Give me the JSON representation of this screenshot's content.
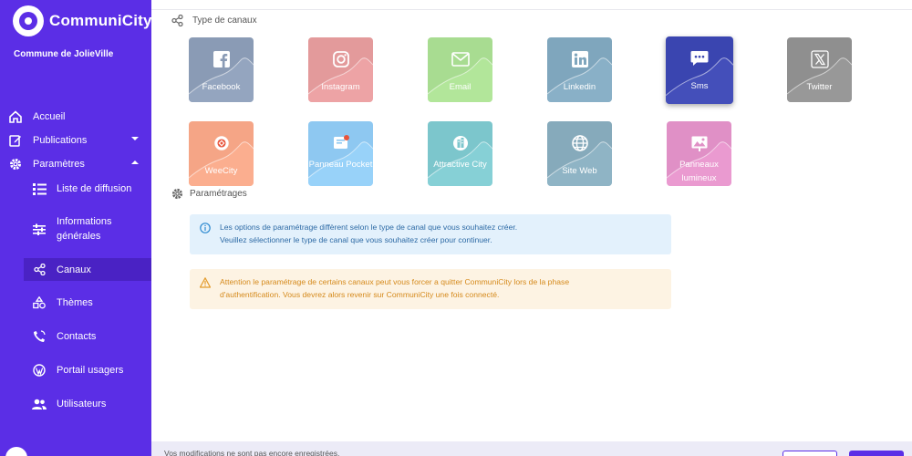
{
  "app": {
    "name": "CommuniCity",
    "commune": "Commune de JolieVille"
  },
  "sidebar": {
    "items": [
      {
        "label": "Accueil",
        "icon": "home-icon"
      },
      {
        "label": "Publications",
        "icon": "edit-icon"
      },
      {
        "label": "Paramètres",
        "icon": "gear-icon"
      }
    ],
    "subitems": [
      {
        "label": "Liste de diffusion",
        "icon": "list-icon"
      },
      {
        "label": "Informations générales",
        "icon": "sliders-icon"
      },
      {
        "label": "Canaux",
        "icon": "share-icon"
      },
      {
        "label": "Thèmes",
        "icon": "shapes-icon"
      },
      {
        "label": "Contacts",
        "icon": "contacts-icon"
      },
      {
        "label": "Portail usagers",
        "icon": "wordpress-icon"
      },
      {
        "label": "Utilisateurs",
        "icon": "users-icon"
      }
    ],
    "active_subitem": "Canaux"
  },
  "main": {
    "section_channels": "Type de canaux",
    "section_settings": "Paramétrages",
    "channels": [
      {
        "label": "Facebook",
        "color": "#8a9bb5",
        "icon": "facebook-icon"
      },
      {
        "label": "Instagram",
        "color": "#e39a9b",
        "icon": "instagram-icon"
      },
      {
        "label": "Email",
        "color": "#a8dc91",
        "icon": "email-icon"
      },
      {
        "label": "Linkedin",
        "color": "#7fa6bd",
        "icon": "linkedin-icon"
      },
      {
        "label": "Sms",
        "color": "#3a45b0",
        "icon": "sms-icon",
        "selected": true
      },
      {
        "label": "Twitter",
        "color": "#8f8f8f",
        "icon": "x-icon"
      },
      {
        "label": "WeeCity",
        "color": "#f5a586",
        "icon": "weecity-icon"
      },
      {
        "label": "Panneau Pocket",
        "color": "#8ec8f1",
        "icon": "panneau-pocket-icon"
      },
      {
        "label": "Attractive City",
        "color": "#7cc6cc",
        "icon": "attractive-city-icon"
      },
      {
        "label": "Site Web",
        "color": "#86aabb",
        "icon": "globe-icon"
      },
      {
        "label": "Panneaux lumineux",
        "color": "#e090c6",
        "icon": "billboard-icon"
      }
    ],
    "info_alert": {
      "line1": "Les options de paramétrage diffèrent selon le type de canal que vous souhaitez créer.",
      "line2": "Veuillez sélectionner le type de canal que vous souhaitez créer pour continuer."
    },
    "warning_alert": {
      "line1": "Attention le paramétrage de certains canaux peut vous forcer a quitter CommuniCity lors de la phase",
      "line2": "d'authentification. Vous devrez alors revenir sur CommuniCity une fois connecté."
    }
  },
  "footer": {
    "message": "Vos modifications ne sont pas encore enregistrées."
  }
}
